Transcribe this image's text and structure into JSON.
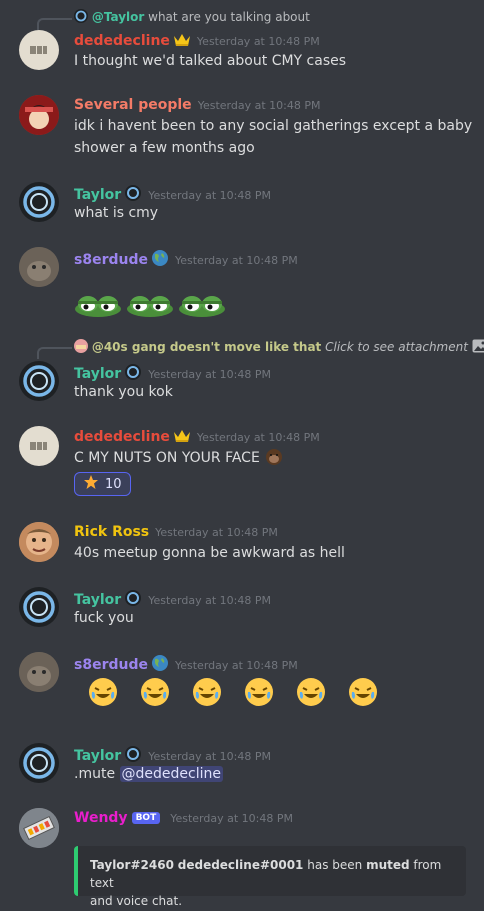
{
  "colors": {
    "background": "#36393f",
    "dededecline": "#e74c3c",
    "several_people": "#f47b67",
    "taylor": "#45c4a0",
    "s8erdude": "#9b84ee",
    "rick_ross": "#f1c40f",
    "wendy": "#e91ecc",
    "timestamp": "#72767d",
    "embed_border": "#2ecc71"
  },
  "messages": [
    {
      "reply_to": {
        "author": "@Taylor",
        "text": "what are you talking about"
      },
      "author": "dededecline",
      "timestamp": "Yesterday at 10:48 PM",
      "text": "I thought we'd talked about CMY cases",
      "badge_icon": "crown-icon"
    },
    {
      "author": "Several people",
      "timestamp": "Yesterday at 10:48 PM",
      "text_line1": "idk i havent been to any social gatherings except a baby",
      "text_line2": "shower a few months ago"
    },
    {
      "author": "Taylor",
      "timestamp": "Yesterday at 10:48 PM",
      "text": "what is cmy",
      "badge_icon": "taylor-badge-icon"
    },
    {
      "author": "s8erdude",
      "timestamp": "Yesterday at 10:48 PM",
      "badge_icon": "globe-icon",
      "content_icons": [
        "frog-eyes-emoji",
        "frog-eyes-emoji",
        "frog-eyes-emoji"
      ]
    },
    {
      "reply_to": {
        "author": "@40s gang doesn't move like that",
        "text": "Click to see attachment"
      },
      "author": "Taylor",
      "timestamp": "Yesterday at 10:48 PM",
      "text": "thank you kok"
    },
    {
      "author": "dededecline",
      "timestamp": "Yesterday at 10:48 PM",
      "text": "C MY NUTS ON YOUR FACE",
      "reaction": {
        "icon": "star-icon",
        "count": "10"
      }
    },
    {
      "author": "Rick Ross",
      "timestamp": "Yesterday at 10:48 PM",
      "text": "40s meetup gonna be awkward as hell"
    },
    {
      "author": "Taylor",
      "timestamp": "Yesterday at 10:48 PM",
      "text": "fuck you"
    },
    {
      "author": "s8erdude",
      "timestamp": "Yesterday at 10:48 PM",
      "content_icons": [
        "laughing-emoji",
        "laughing-emoji",
        "laughing-emoji",
        "laughing-emoji",
        "laughing-emoji",
        "laughing-emoji"
      ]
    },
    {
      "author": "Taylor",
      "timestamp": "Yesterday at 10:48 PM",
      "text_prefix": ".mute",
      "mention": "@dededecline"
    },
    {
      "author": "Wendy",
      "bot_tag": "BOT",
      "timestamp": "Yesterday at 10:48 PM",
      "embed": {
        "user1": "Taylor#2460",
        "user2": "dededecline#0001",
        "mid": " has been ",
        "action": "muted",
        "tail": " from text",
        "line2": "and voice chat."
      }
    }
  ]
}
